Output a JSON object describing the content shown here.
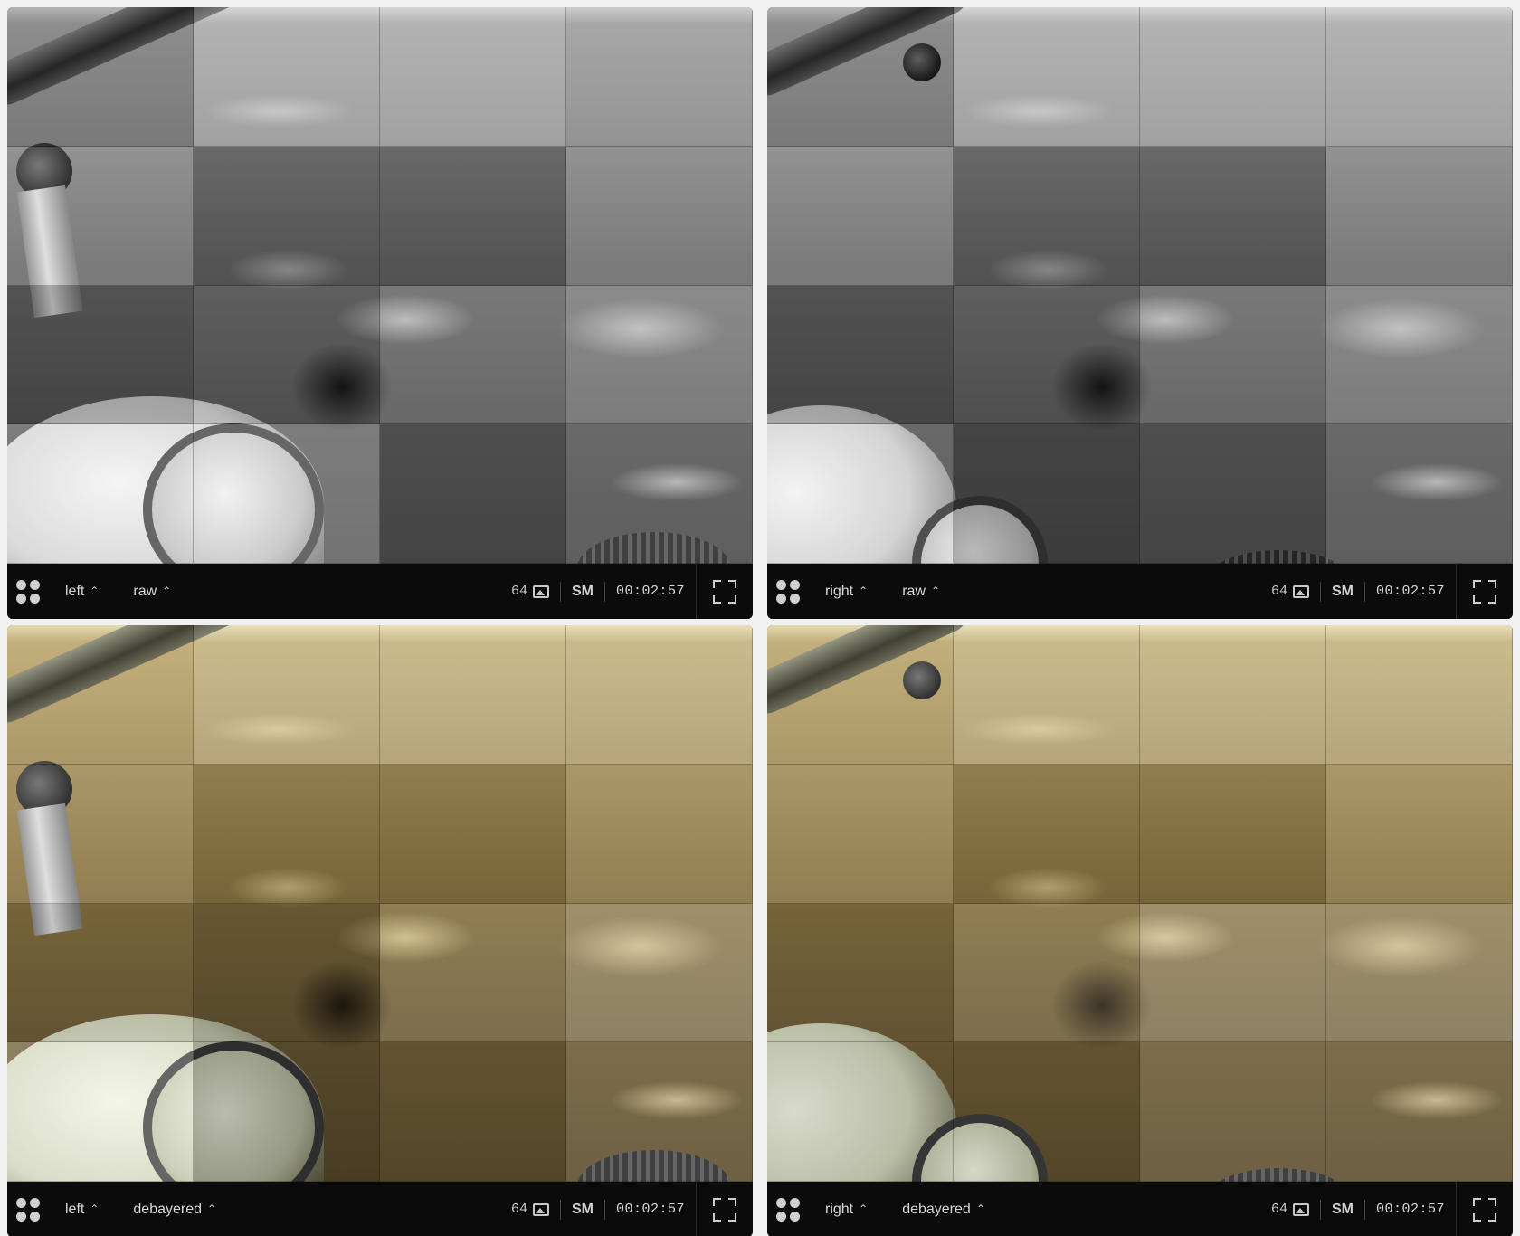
{
  "viewers": [
    {
      "camera": "left",
      "mode": "raw",
      "frame_count": "64",
      "size_label": "SM",
      "timestamp": "00:02:57",
      "palette": "grayscale"
    },
    {
      "camera": "right",
      "mode": "raw",
      "frame_count": "64",
      "size_label": "SM",
      "timestamp": "00:02:57",
      "palette": "grayscale"
    },
    {
      "camera": "left",
      "mode": "debayered",
      "frame_count": "64",
      "size_label": "SM",
      "timestamp": "00:02:57",
      "palette": "color"
    },
    {
      "camera": "right",
      "mode": "debayered",
      "frame_count": "64",
      "size_label": "SM",
      "timestamp": "00:02:57",
      "palette": "color"
    }
  ],
  "icons": {
    "layout": "grid-dots-icon",
    "dropdown": "chevron-up-icon",
    "images": "image-icon",
    "fullscreen": "expand-icon"
  },
  "colors": {
    "toolbar_bg": "#0b0b0b",
    "page_bg": "#f1f1f1"
  }
}
